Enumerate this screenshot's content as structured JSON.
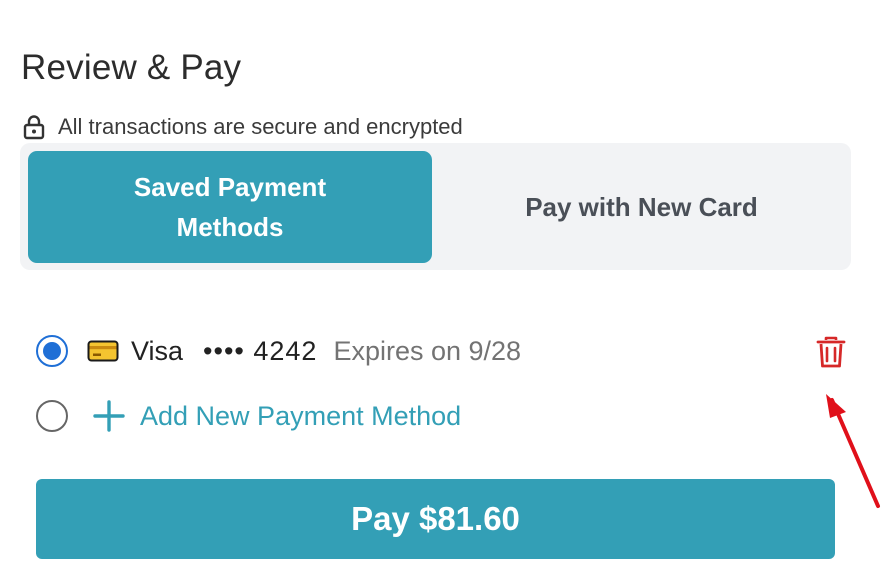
{
  "page": {
    "title": "Review & Pay",
    "secure_note": "All transactions are secure and encrypted"
  },
  "tabs": [
    {
      "label": "Saved Payment Methods",
      "active": true
    },
    {
      "label": "Pay with New Card",
      "active": false
    }
  ],
  "saved_methods": [
    {
      "brand": "Visa",
      "masked_number": "•••• 4242",
      "expiry": "Expires on 9/28",
      "selected": true,
      "icon": "credit-card-icon"
    }
  ],
  "add_method": {
    "label": "Add New Payment Method",
    "selected": false,
    "icon": "plus-icon"
  },
  "pay_button": {
    "label": "Pay $81.60"
  },
  "colors": {
    "accent": "#339fb6",
    "radio_selected": "#1f6fd6",
    "delete": "#d62828",
    "annotation_arrow": "#e0101a"
  }
}
